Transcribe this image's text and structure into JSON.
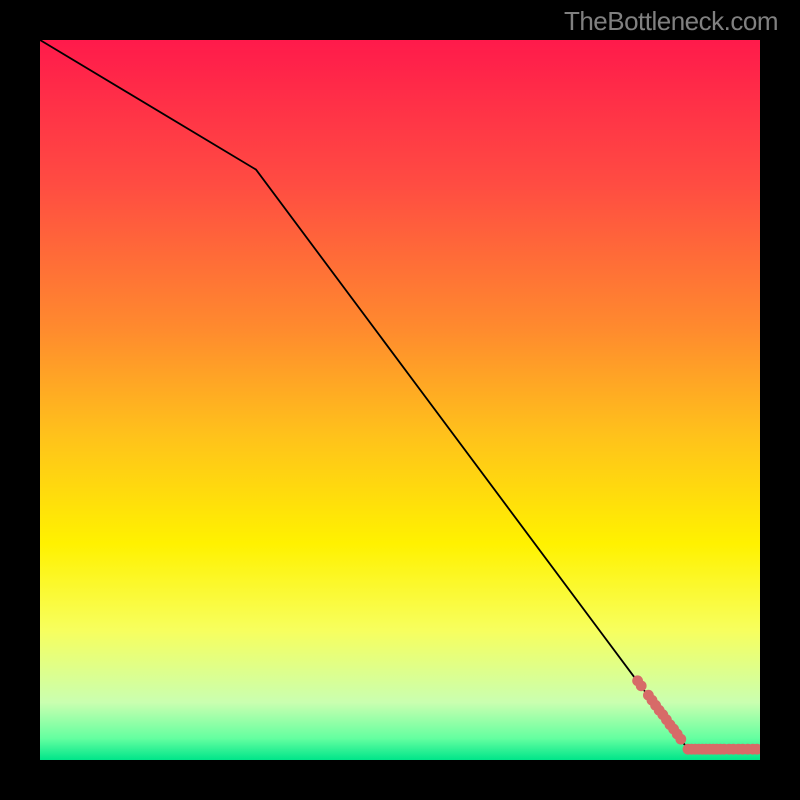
{
  "attribution": "TheBottleneck.com",
  "chart_data": {
    "type": "line",
    "title": "",
    "xlabel": "",
    "ylabel": "",
    "xlim": [
      0,
      100
    ],
    "ylim": [
      0,
      100
    ],
    "grid": false,
    "legend": false,
    "background_gradient": {
      "stops": [
        {
          "pos": 0.0,
          "color": "#ff1a4b"
        },
        {
          "pos": 0.2,
          "color": "#ff4c42"
        },
        {
          "pos": 0.4,
          "color": "#ff8a2e"
        },
        {
          "pos": 0.55,
          "color": "#ffc21b"
        },
        {
          "pos": 0.7,
          "color": "#fff200"
        },
        {
          "pos": 0.82,
          "color": "#f7ff5e"
        },
        {
          "pos": 0.92,
          "color": "#caffb0"
        },
        {
          "pos": 0.97,
          "color": "#64ffa0"
        },
        {
          "pos": 1.0,
          "color": "#00e58a"
        }
      ]
    },
    "series": [
      {
        "name": "curve",
        "stroke": "#000000",
        "x": [
          0,
          30,
          90,
          100
        ],
        "values": [
          100,
          82,
          1.5,
          1.5
        ]
      }
    ],
    "points": {
      "name": "data-points",
      "color": "#d76b68",
      "x": [
        83.0,
        83.5,
        84.5,
        85.0,
        85.5,
        86.0,
        86.5,
        87.0,
        87.5,
        88.0,
        88.5,
        89.0,
        90.0,
        90.5,
        91.0,
        91.5,
        92.0,
        92.5,
        93.0,
        93.5,
        94.0,
        94.5,
        95.0,
        95.7,
        96.3,
        97.0,
        97.6,
        98.3,
        99.0,
        99.6
      ],
      "y": [
        11.0,
        10.3,
        9.0,
        8.3,
        7.6,
        6.9,
        6.3,
        5.6,
        4.9,
        4.3,
        3.6,
        2.9,
        1.5,
        1.5,
        1.5,
        1.5,
        1.5,
        1.5,
        1.5,
        1.5,
        1.5,
        1.5,
        1.5,
        1.5,
        1.5,
        1.5,
        1.5,
        1.5,
        1.5,
        1.5
      ]
    }
  }
}
